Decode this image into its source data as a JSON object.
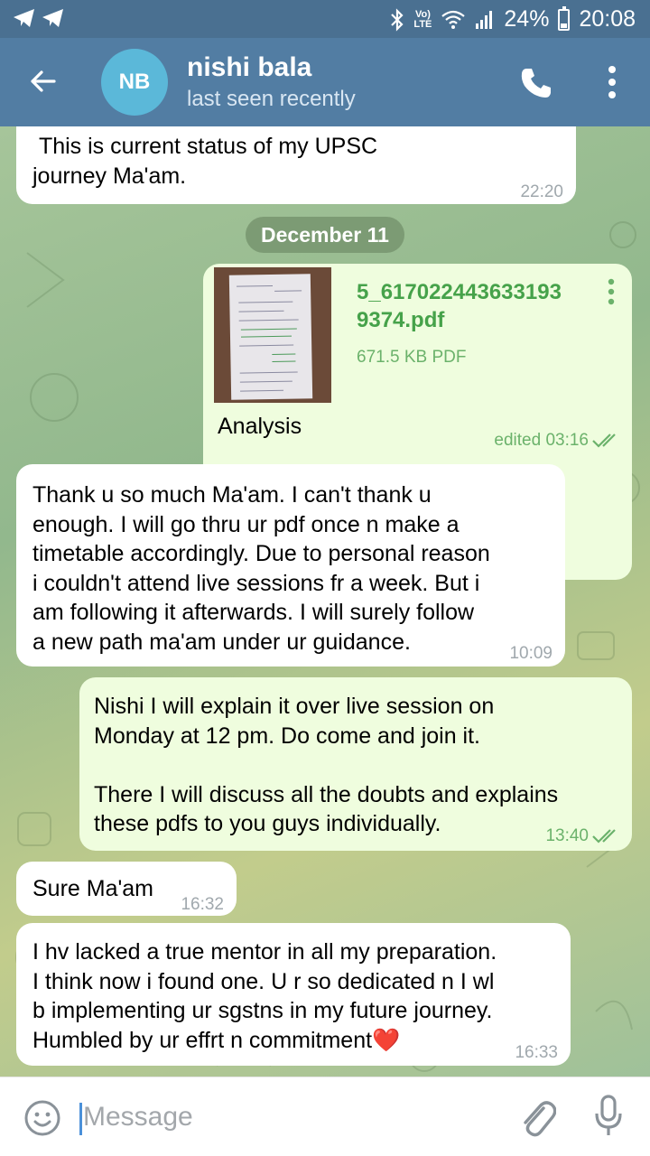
{
  "status_bar": {
    "volte": "Vo)",
    "lte": "LTE",
    "battery": "24%",
    "battery_level": 0.24,
    "time": "20:08"
  },
  "header": {
    "avatar_initials": "NB",
    "avatar_color": "#5bb8d9",
    "name": "nishi bala",
    "status": "last seen recently"
  },
  "date_separator": "December 11",
  "messages": [
    {
      "direction": "in",
      "text": " This is current status of my UPSC\njourney Ma'am.",
      "time": "22:20"
    },
    {
      "direction": "out",
      "type": "file",
      "file_name": "5_6170224436331939374.pdf",
      "file_name_line1": "5_617022443633193",
      "file_name_line2": "9374.pdf",
      "file_size": "671.5 KB PDF",
      "caption": "Analysis",
      "time": "edited 03:16"
    },
    {
      "direction": "in",
      "text": "Thank u so much Ma'am. I can't thank u\nenough. I will go thru ur pdf once n make a\ntimetable accordingly. Due to personal reason\ni couldn't attend live sessions fr a week. But i\nam following it afterwards. I will surely follow\na new path ma'am under ur guidance.",
      "time": "10:09"
    },
    {
      "direction": "out",
      "text": "Nishi I will explain it over live session on\nMonday at 12 pm. Do come and join it.\n\nThere I will discuss all the doubts and explains\nthese pdfs to you guys individually.",
      "time": "13:40"
    },
    {
      "direction": "in",
      "text": "Sure Ma'am",
      "time": "16:32"
    },
    {
      "direction": "in",
      "text": "I hv lacked a true mentor in all my preparation.\nI think now i found one. U r so dedicated n I wl\nb implementing ur sgstns in my future journey.\nHumbled by ur effrt n commitment❤️",
      "time": "16:33"
    }
  ],
  "input": {
    "placeholder": "Message"
  },
  "colors": {
    "header": "#527da3",
    "status_bar": "#4a7091",
    "incoming_bubble": "#ffffff",
    "outgoing_bubble": "#effdde",
    "outgoing_meta": "#6bb26b",
    "file_name": "#46a24a"
  },
  "icons": [
    "back-arrow-icon",
    "phone-icon",
    "more-vertical-icon",
    "emoji-icon",
    "attach-icon",
    "microphone-icon",
    "double-check-icon",
    "bluetooth-icon",
    "wifi-icon",
    "signal-icon",
    "battery-icon",
    "telegram-notification-icon"
  ]
}
